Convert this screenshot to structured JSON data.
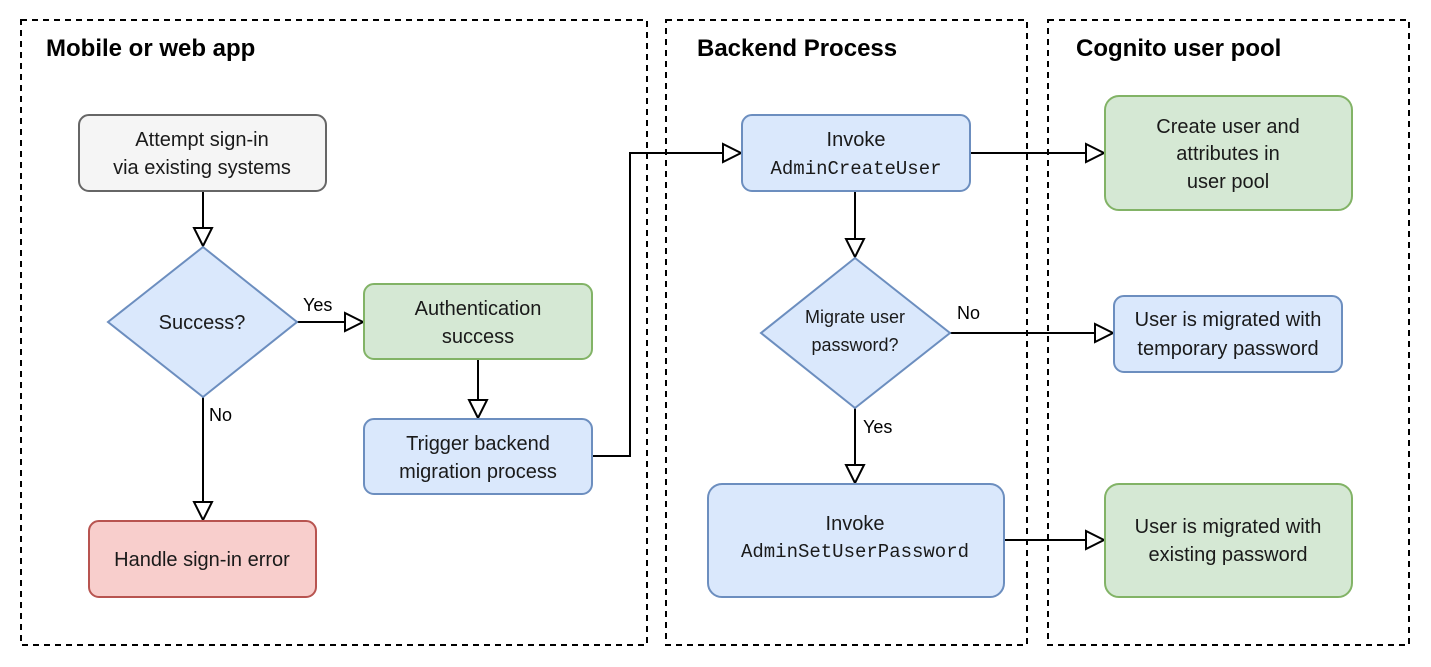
{
  "groups": [
    {
      "id": "mobile",
      "title": "Mobile or web app"
    },
    {
      "id": "backend",
      "title": "Backend Process"
    },
    {
      "id": "cognito",
      "title": "Cognito user pool"
    }
  ],
  "nodes": {
    "attempt_signin": {
      "lines": [
        "Attempt sign-in",
        "via existing systems"
      ],
      "fill": "#f5f5f5",
      "stroke": "#666666"
    },
    "success_decision": {
      "lines": [
        "Success?"
      ],
      "fill": "#dae8fc",
      "stroke": "#6c8ebf"
    },
    "auth_success": {
      "lines": [
        "Authentication",
        "success"
      ],
      "fill": "#d5e8d4",
      "stroke": "#82b366"
    },
    "trigger_backend": {
      "lines": [
        "Trigger backend",
        "migration process"
      ],
      "fill": "#dae8fc",
      "stroke": "#6c8ebf"
    },
    "handle_error": {
      "lines": [
        "Handle sign-in error"
      ],
      "fill": "#f8cecc",
      "stroke": "#b85450"
    },
    "invoke_create": {
      "title": "Invoke",
      "code": "AdminCreateUser",
      "fill": "#dae8fc",
      "stroke": "#6c8ebf"
    },
    "migrate_decision": {
      "lines": [
        "Migrate user",
        "password?"
      ],
      "fill": "#dae8fc",
      "stroke": "#6c8ebf"
    },
    "invoke_setpw": {
      "title": "Invoke",
      "code": "AdminSetUserPassword",
      "fill": "#dae8fc",
      "stroke": "#6c8ebf"
    },
    "create_user": {
      "lines": [
        "Create user and",
        "attributes in",
        "user pool"
      ],
      "fill": "#d5e8d4",
      "stroke": "#82b366"
    },
    "migrated_temp": {
      "lines": [
        "User is migrated with",
        "temporary password"
      ],
      "fill": "#dae8fc",
      "stroke": "#6c8ebf"
    },
    "migrated_existing": {
      "lines": [
        "User is migrated with",
        "existing password"
      ],
      "fill": "#d5e8d4",
      "stroke": "#82b366"
    }
  },
  "edges": [
    {
      "from": "attempt_signin",
      "to": "success_decision",
      "label": ""
    },
    {
      "from": "success_decision",
      "to": "auth_success",
      "label": "Yes"
    },
    {
      "from": "success_decision",
      "to": "handle_error",
      "label": "No"
    },
    {
      "from": "auth_success",
      "to": "trigger_backend",
      "label": ""
    },
    {
      "from": "trigger_backend",
      "to": "invoke_create",
      "label": ""
    },
    {
      "from": "invoke_create",
      "to": "create_user",
      "label": ""
    },
    {
      "from": "invoke_create",
      "to": "migrate_decision",
      "label": ""
    },
    {
      "from": "migrate_decision",
      "to": "migrated_temp",
      "label": "No"
    },
    {
      "from": "migrate_decision",
      "to": "invoke_setpw",
      "label": "Yes"
    },
    {
      "from": "invoke_setpw",
      "to": "migrated_existing",
      "label": ""
    }
  ]
}
